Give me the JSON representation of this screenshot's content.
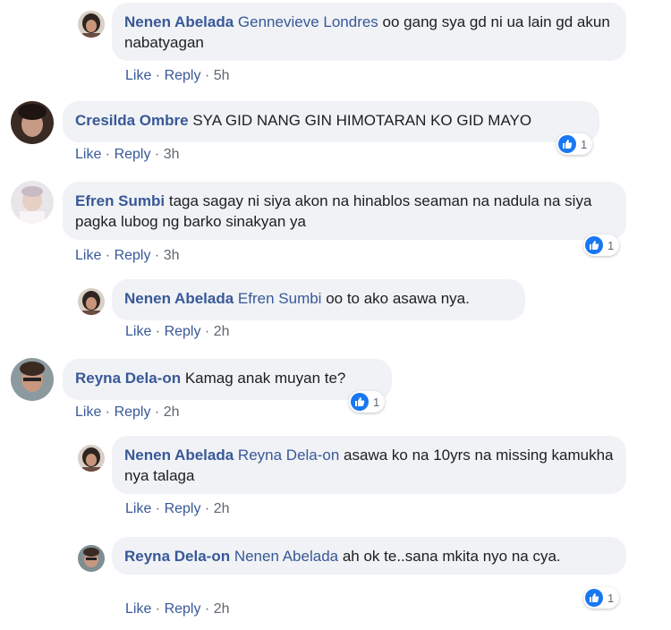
{
  "actions": {
    "like": "Like",
    "reply": "Reply",
    "separator": " · "
  },
  "comments": [
    {
      "author": "Nenen Abelada",
      "tag": "Gennevieve Londres",
      "text": " oo gang sya gd ni ua lain gd akun nabatyagan",
      "time": "5h",
      "reactions": null
    },
    {
      "author": "Cresilda Ombre",
      "tag": "",
      "text": " SYA GID NANG GIN HIMOTARAN KO GID MAYO",
      "time": "3h",
      "reactions": "1"
    },
    {
      "author": "Efren Sumbi",
      "tag": "",
      "text": " taga sagay ni siya akon na hinablos seaman na nadula na siya pagka lubog ng barko sinakyan ya",
      "time": "3h",
      "reactions": "1"
    },
    {
      "author": "Nenen Abelada",
      "tag": "Efren Sumbi",
      "text": " oo to ako asawa nya.",
      "time": "2h",
      "reactions": null
    },
    {
      "author": "Reyna Dela-on",
      "tag": "",
      "text": " Kamag anak muyan te?",
      "time": "2h",
      "reactions": "1"
    },
    {
      "author": "Nenen Abelada",
      "tag": "Reyna Dela-on",
      "text": " asawa ko na 10yrs na missing kamukha nya talaga",
      "time": "2h",
      "reactions": null
    },
    {
      "author": "Reyna Dela-on",
      "tag": "Nenen Abelada",
      "text": " ah ok te..sana mkita nyo na cya.",
      "time": "2h",
      "reactions": "1"
    }
  ],
  "colors": {
    "link": "#385898",
    "bubble": "#f0f2f5",
    "like": "#1877f2",
    "meta": "#606770"
  }
}
